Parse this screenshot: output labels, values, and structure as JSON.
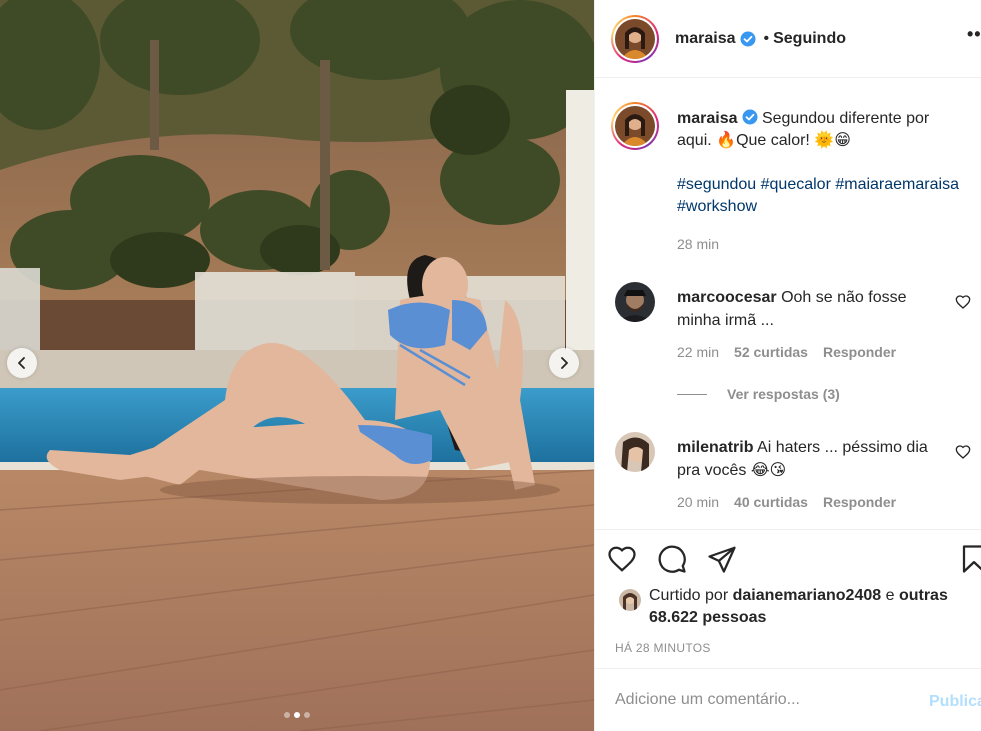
{
  "post": {
    "username": "maraisa",
    "separator": "•",
    "follow_status": "Seguindo",
    "more_label": "••",
    "caption_text": "Segundou diferente por aqui. 🔥Que calor! 🌞😁",
    "hashtags": "#segundou #quecalor #maiaraemaraisa #workshow",
    "caption_time": "28 min"
  },
  "comments": [
    {
      "username": "marcoocesar",
      "text": "Ooh se não fosse minha irmã ...",
      "time": "22 min",
      "likes": "52 curtidas",
      "reply": "Responder"
    },
    {
      "username": "milenatrib",
      "text": "Ai haters ... péssimo dia pra vocês 😂😘",
      "time": "20 min",
      "likes": "40 curtidas",
      "reply": "Responder"
    }
  ],
  "view_replies": "Ver respostas (3)",
  "likes": {
    "prefix": "Curtido por",
    "user": "daianemariano2408",
    "conj": "e",
    "others": "outras 68.622 pessoas"
  },
  "posted_ago": "HÁ 28 MINUTOS",
  "add_comment": {
    "placeholder": "Adicione um comentário...",
    "publish": "Publicar"
  },
  "carousel": {
    "count": 3,
    "active_index": 1
  },
  "icons": {
    "verified": "verified-badge-icon",
    "like": "heart-icon",
    "comment": "comment-icon",
    "share": "paper-plane-icon",
    "save": "bookmark-icon"
  },
  "colors": {
    "verified": "#3897f0",
    "link": "#00376b",
    "muted": "#8e8e8e",
    "publish_disabled": "#b2dffc"
  }
}
